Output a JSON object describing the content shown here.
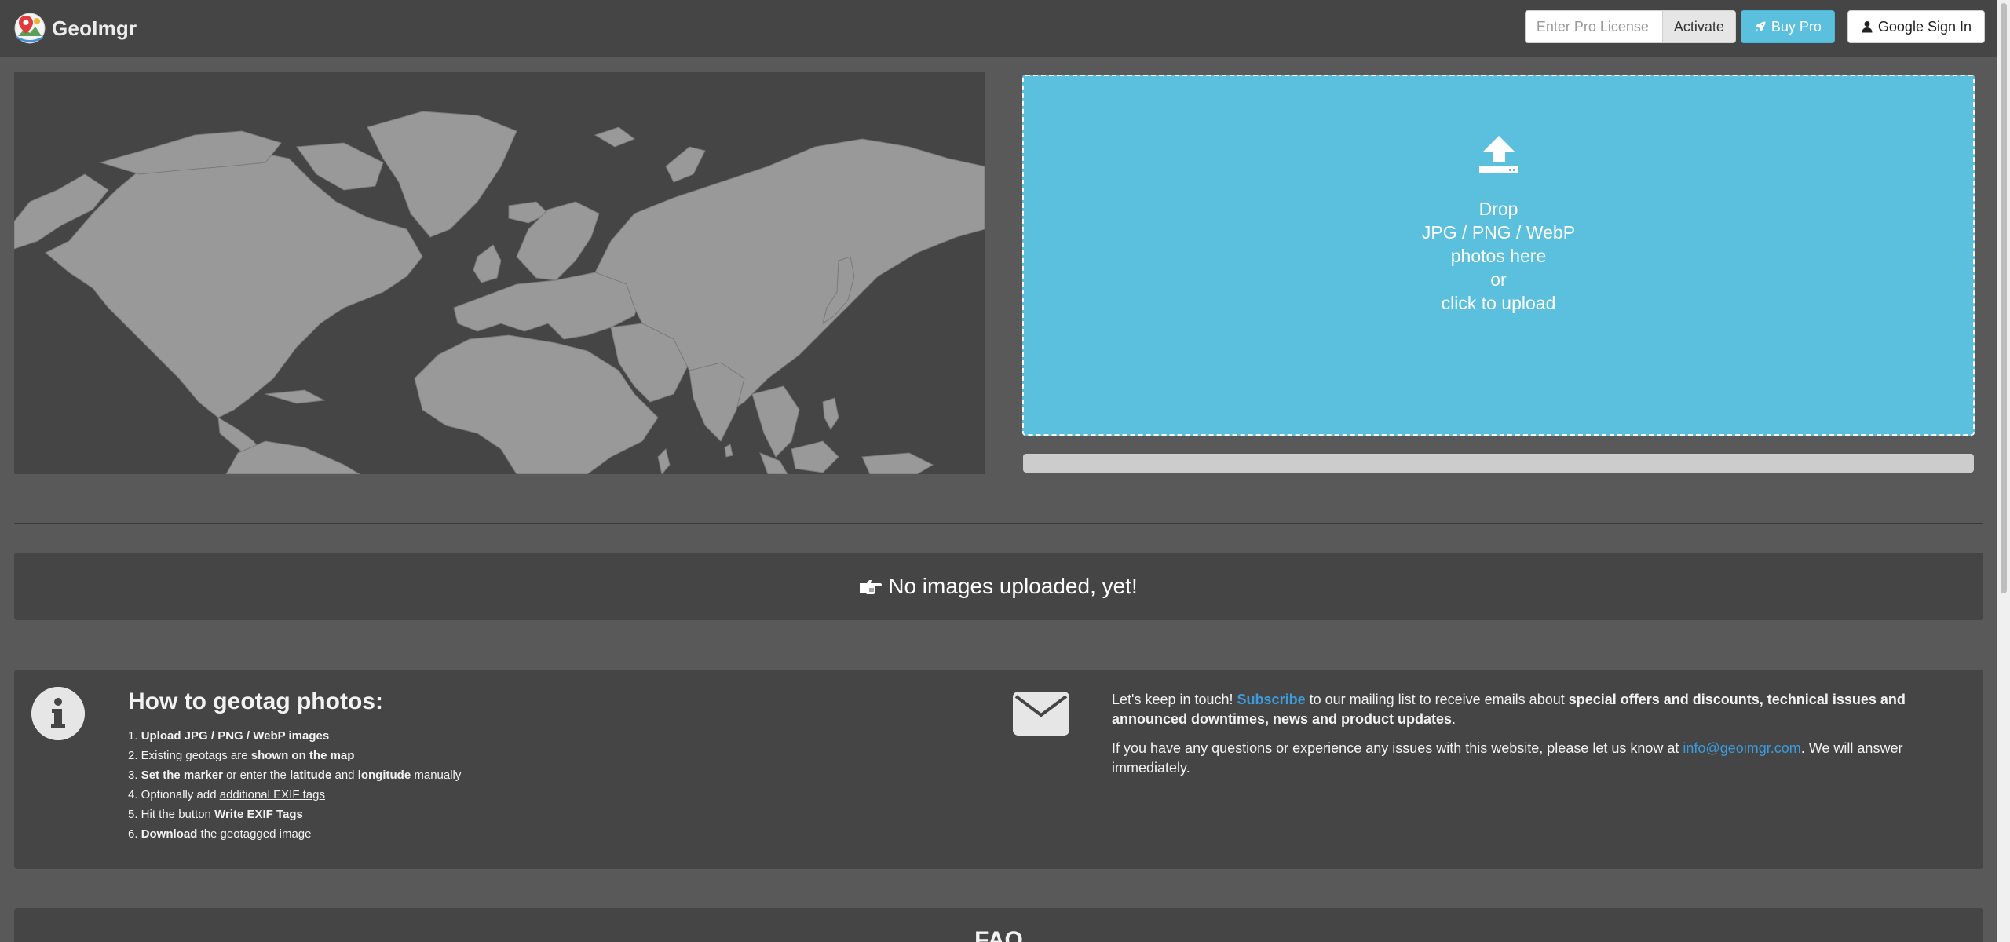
{
  "navbar": {
    "brand": "GeoImgr",
    "license_placeholder": "Enter Pro License",
    "activate_label": "Activate",
    "buy_pro_label": "Buy Pro",
    "sign_in_label": "Google Sign In"
  },
  "dropzone": {
    "line1": "Drop",
    "line2": "JPG / PNG / WebP",
    "line3": "photos here",
    "line4": "or",
    "line5": "click to upload"
  },
  "upload_progress": 0,
  "no_images": {
    "text": "No images uploaded, yet!"
  },
  "howto": {
    "title": "How to geotag photos:",
    "s1_n": "1. ",
    "s1_b": "Upload JPG / PNG / WebP images",
    "s2_a": "2. Existing geotags are ",
    "s2_b": "shown on the map",
    "s3_n": "3. ",
    "s3_b1": "Set the marker",
    "s3_t1": " or enter the ",
    "s3_b2": "latitude",
    "s3_t2": " and ",
    "s3_b3": "longitude",
    "s3_t3": " manually",
    "s4_a": "4. Optionally add ",
    "s4_u": "additional EXIF tags",
    "s5_a": "5. Hit the button ",
    "s5_b": "Write EXIF Tags",
    "s6_n": "6. ",
    "s6_b": "Download",
    "s6_t": " the geotagged image"
  },
  "contact": {
    "p1_a": "Let's keep in touch! ",
    "p1_link": "Subscribe",
    "p1_b": " to our mailing list to receive emails about ",
    "p1_bold": "special offers and discounts, technical issues and announced downtimes, news and product updates",
    "p1_end": ".",
    "p2_a": "If you have any questions or experience any issues with this website, please let us know at ",
    "p2_email": "info@geoimgr.com",
    "p2_b": ". We will answer immediately."
  },
  "faq": {
    "title": "FAQ"
  },
  "colors": {
    "accent": "#5bc0de",
    "link": "#3c9bdc",
    "panel": "#454545",
    "background": "#595959",
    "land": "#999999"
  }
}
